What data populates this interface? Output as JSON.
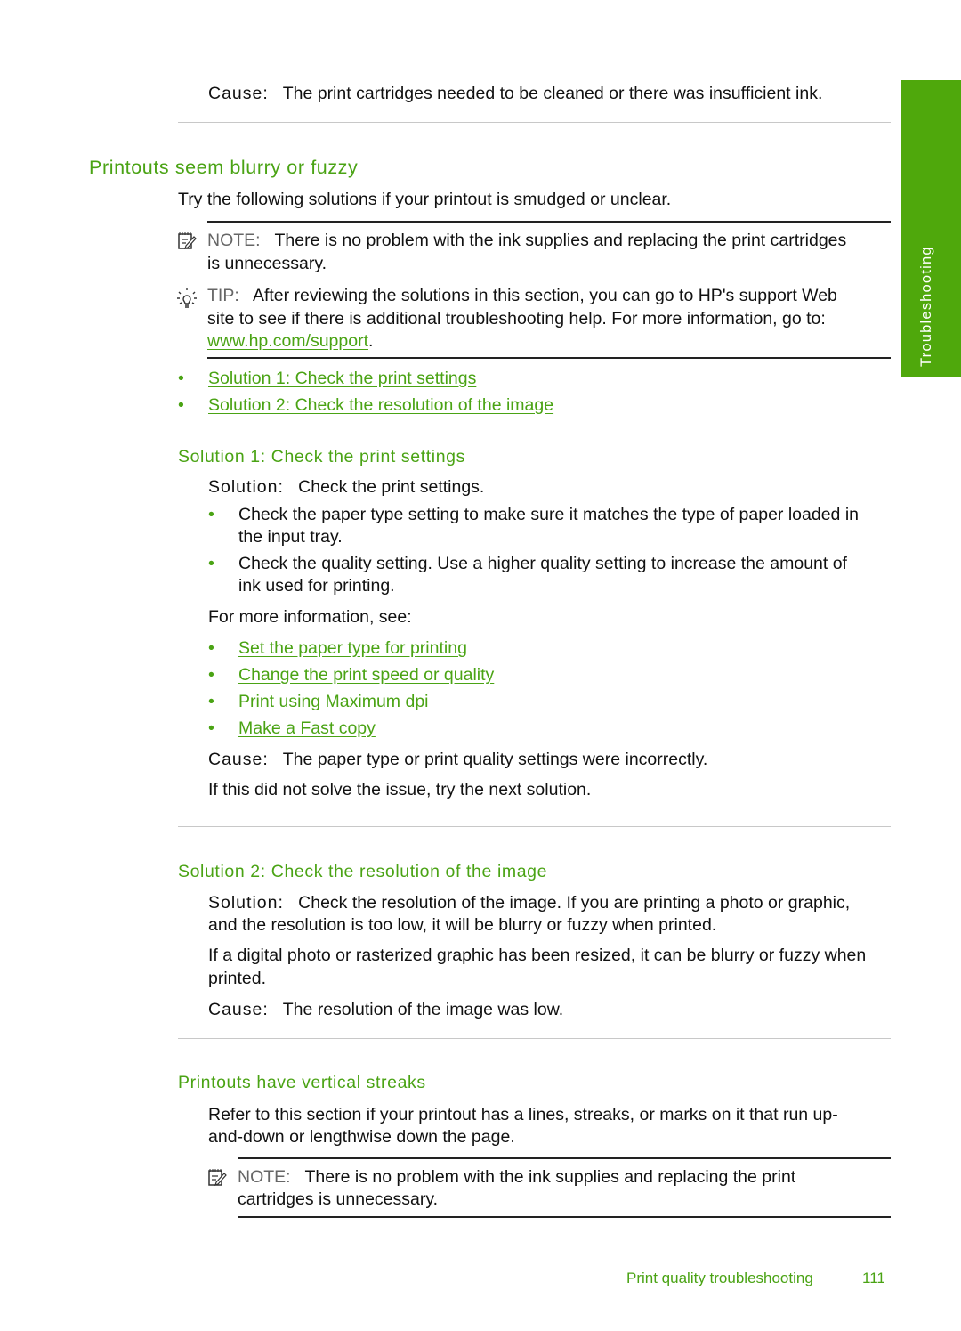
{
  "side_tab": "Troubleshooting",
  "top_cause": {
    "label": "Cause:",
    "text": "The print cartridges needed to be cleaned or there was insufficient ink."
  },
  "section": {
    "title": "Printouts seem blurry or fuzzy",
    "intro": "Try the following solutions if your printout is smudged or unclear.",
    "note": {
      "label": "NOTE:",
      "line1": "There is no problem with the ink supplies and replacing the print cartridges",
      "line2": "is unnecessary."
    },
    "tip": {
      "label": "TIP:",
      "line1": "After reviewing the solutions in this section, you can go to HP's support Web",
      "line2": "site to see if there is additional troubleshooting help. For more information, go to:",
      "link": "www.hp.com/support",
      "after": "."
    },
    "links": [
      "Solution 1: Check the print settings",
      "Solution 2: Check the resolution of the image"
    ]
  },
  "solution1": {
    "title": "Solution 1: Check the print settings",
    "solution_label": "Solution:",
    "solution_text": "Check the print settings.",
    "bullets": [
      {
        "line1": "Check the paper type setting to make sure it matches the type of paper loaded in",
        "line2": "the input tray."
      },
      {
        "line1": "Check the quality setting. Use a higher quality setting to increase the amount of",
        "line2": "ink used for printing."
      }
    ],
    "more_info": "For more information, see:",
    "links": [
      "Set the paper type for printing",
      "Change the print speed or quality",
      "Print using Maximum dpi",
      "Make a Fast copy"
    ],
    "cause_label": "Cause:",
    "cause_text": "The paper type or print quality settings were incorrectly.",
    "next": "If this did not solve the issue, try the next solution."
  },
  "solution2": {
    "title": "Solution 2: Check the resolution of the image",
    "solution_label": "Solution:",
    "line1": "Check the resolution of the image. If you are printing a photo or graphic,",
    "line2": "and the resolution is too low, it will be blurry or fuzzy when printed.",
    "para_line1": "If a digital photo or rasterized graphic has been resized, it can be blurry or fuzzy when",
    "para_line2": "printed.",
    "cause_label": "Cause:",
    "cause_text": "The resolution of the image was low."
  },
  "streaks": {
    "title": "Printouts have vertical streaks",
    "line1": "Refer to this section if your printout has a lines, streaks, or marks on it that run up-",
    "line2": "and-down or lengthwise down the page.",
    "note": {
      "label": "NOTE:",
      "line1": "There is no problem with the ink supplies and replacing the print",
      "line2": "cartridges is unnecessary."
    }
  },
  "footer": {
    "section": "Print quality troubleshooting",
    "page": "111"
  }
}
